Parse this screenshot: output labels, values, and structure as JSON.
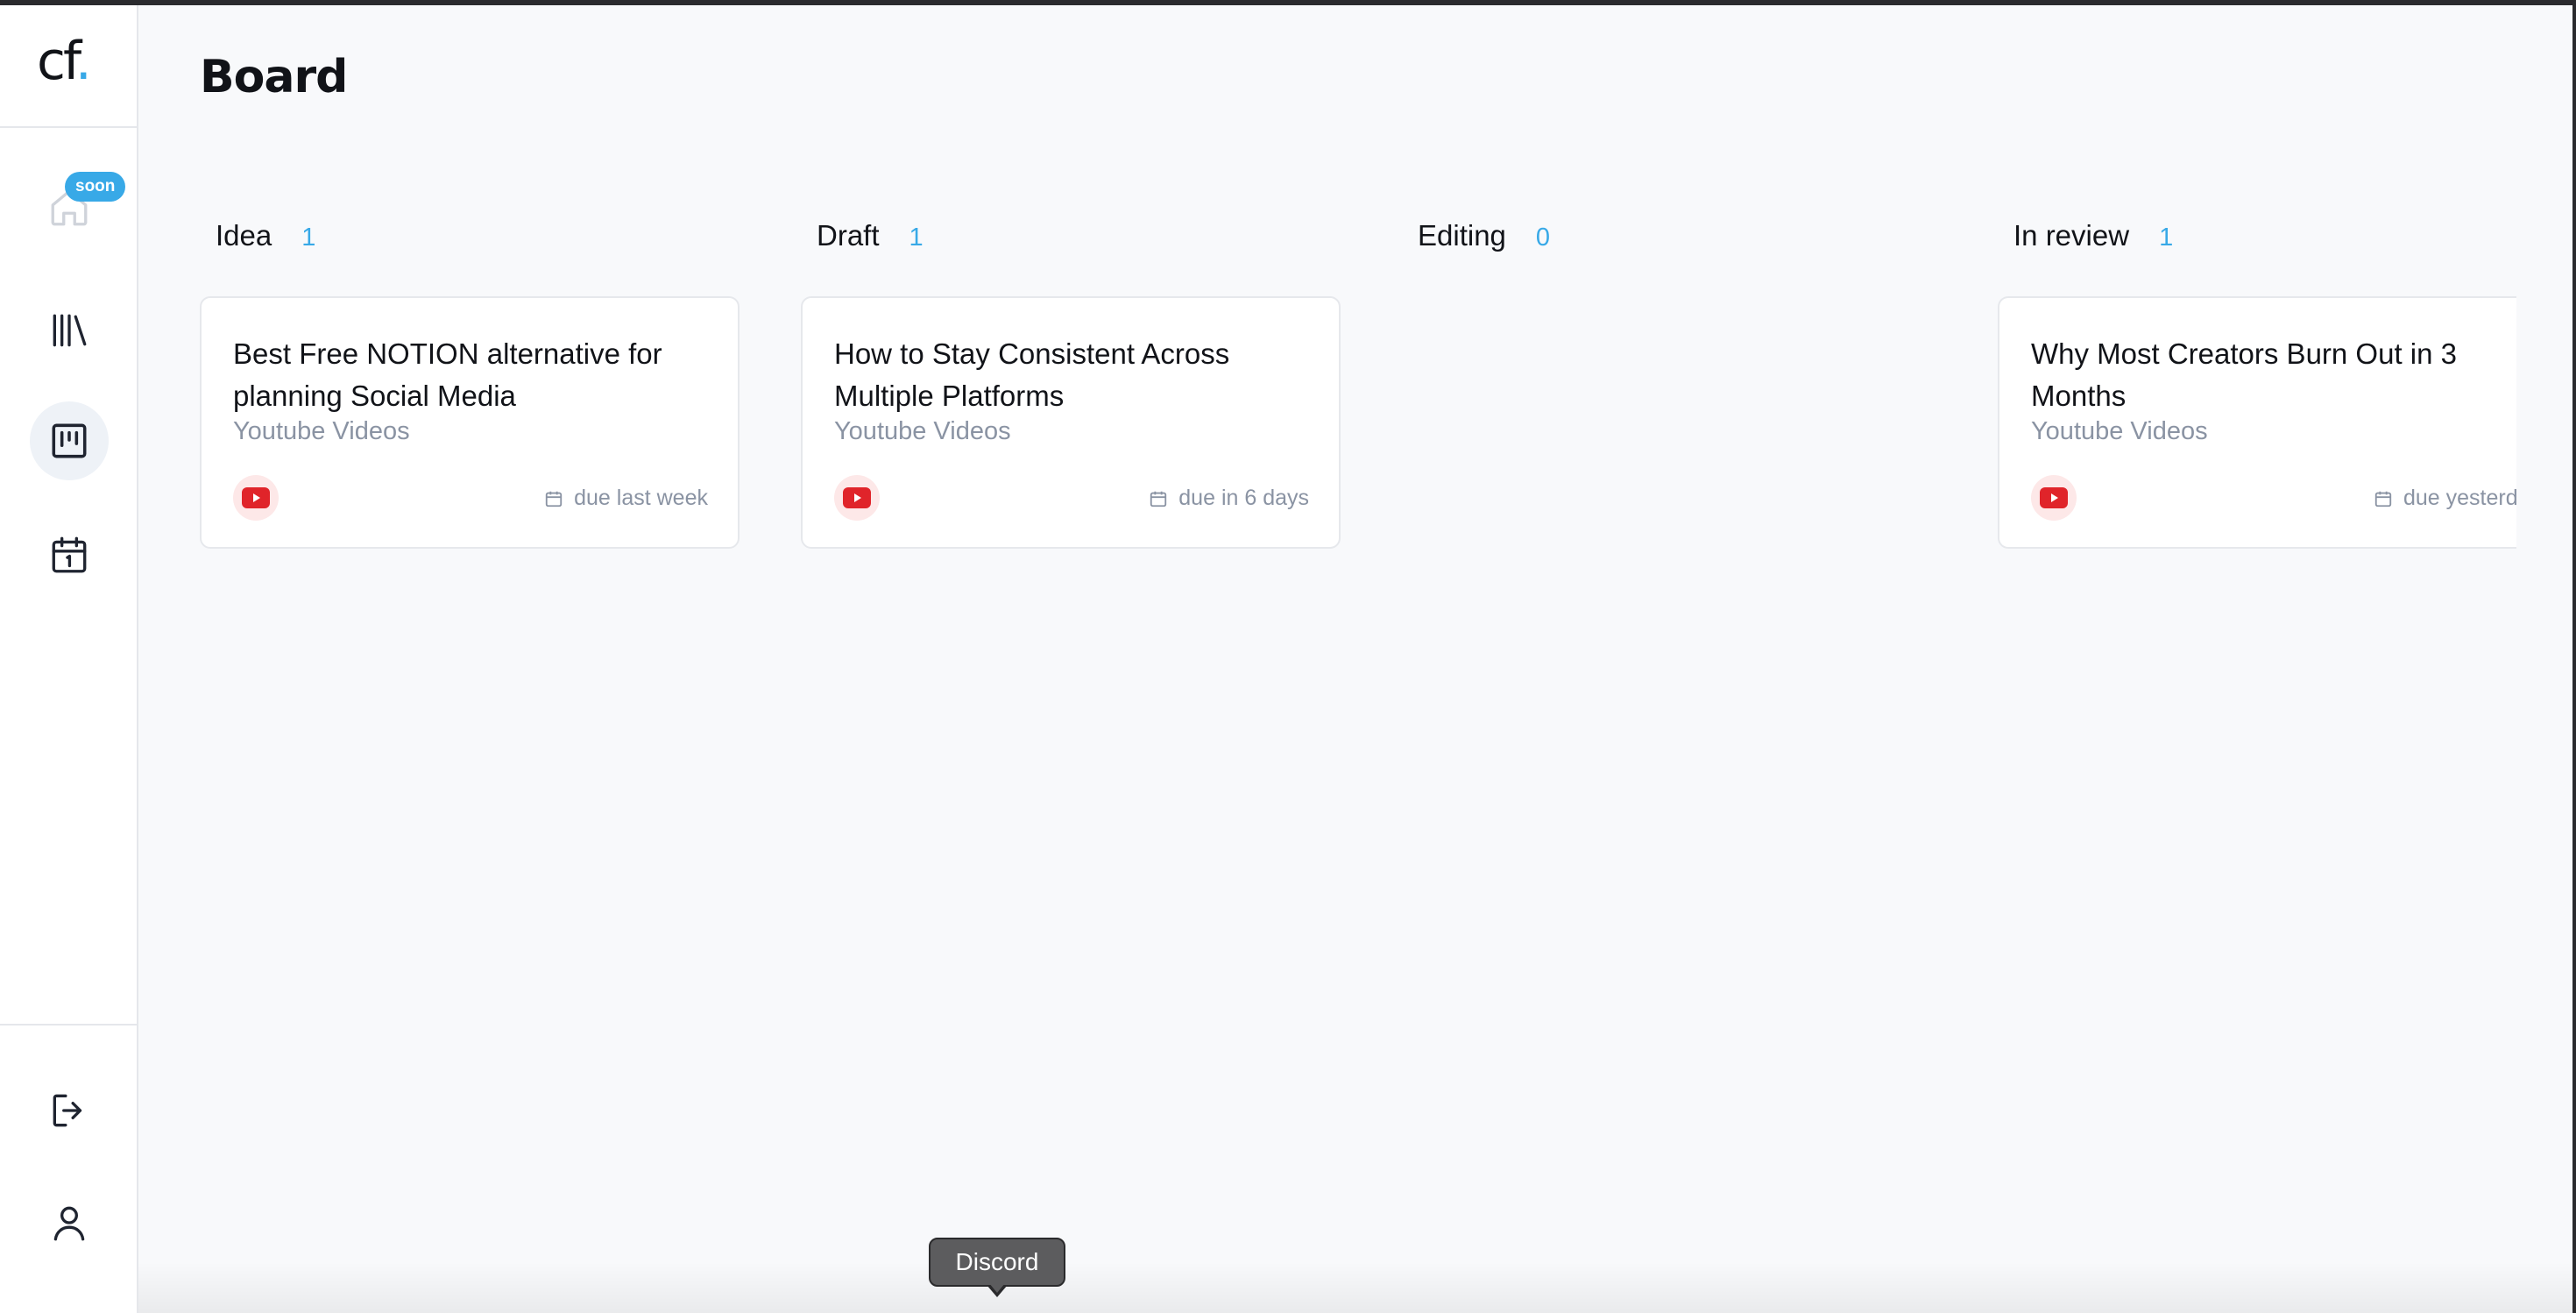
{
  "app": {
    "logo_text": "cf",
    "logo_dot": ".",
    "accent_color": "#38a9e7"
  },
  "sidebar": {
    "items": [
      {
        "name": "home",
        "icon": "home-icon",
        "badge": "soon",
        "active": false
      },
      {
        "name": "library",
        "icon": "library-icon",
        "active": false
      },
      {
        "name": "board",
        "icon": "kanban-icon",
        "active": true
      },
      {
        "name": "calendar",
        "icon": "calendar-icon",
        "active": false
      }
    ],
    "bottom_items": [
      {
        "name": "logout",
        "icon": "logout-icon"
      },
      {
        "name": "profile",
        "icon": "user-icon"
      }
    ]
  },
  "page": {
    "title": "Board"
  },
  "columns": [
    {
      "title": "Idea",
      "count": "1",
      "cards": [
        {
          "title": "Best Free NOTION alternative for planning Social Media",
          "category": "Youtube Videos",
          "platform": "youtube-icon",
          "due": "due last week"
        }
      ]
    },
    {
      "title": "Draft",
      "count": "1",
      "cards": [
        {
          "title": "How to Stay Consistent Across Multiple Platforms",
          "category": "Youtube Videos",
          "platform": "youtube-icon",
          "due": "due in 6 days"
        }
      ]
    },
    {
      "title": "Editing",
      "count": "0",
      "cards": []
    },
    {
      "title": "In review",
      "count": "1",
      "cards": [
        {
          "title": "Why Most Creators Burn Out in 3 Months",
          "category": "Youtube Videos",
          "platform": "youtube-icon",
          "due": "due yesterday"
        }
      ]
    }
  ],
  "tooltip": {
    "text": "Discord"
  }
}
